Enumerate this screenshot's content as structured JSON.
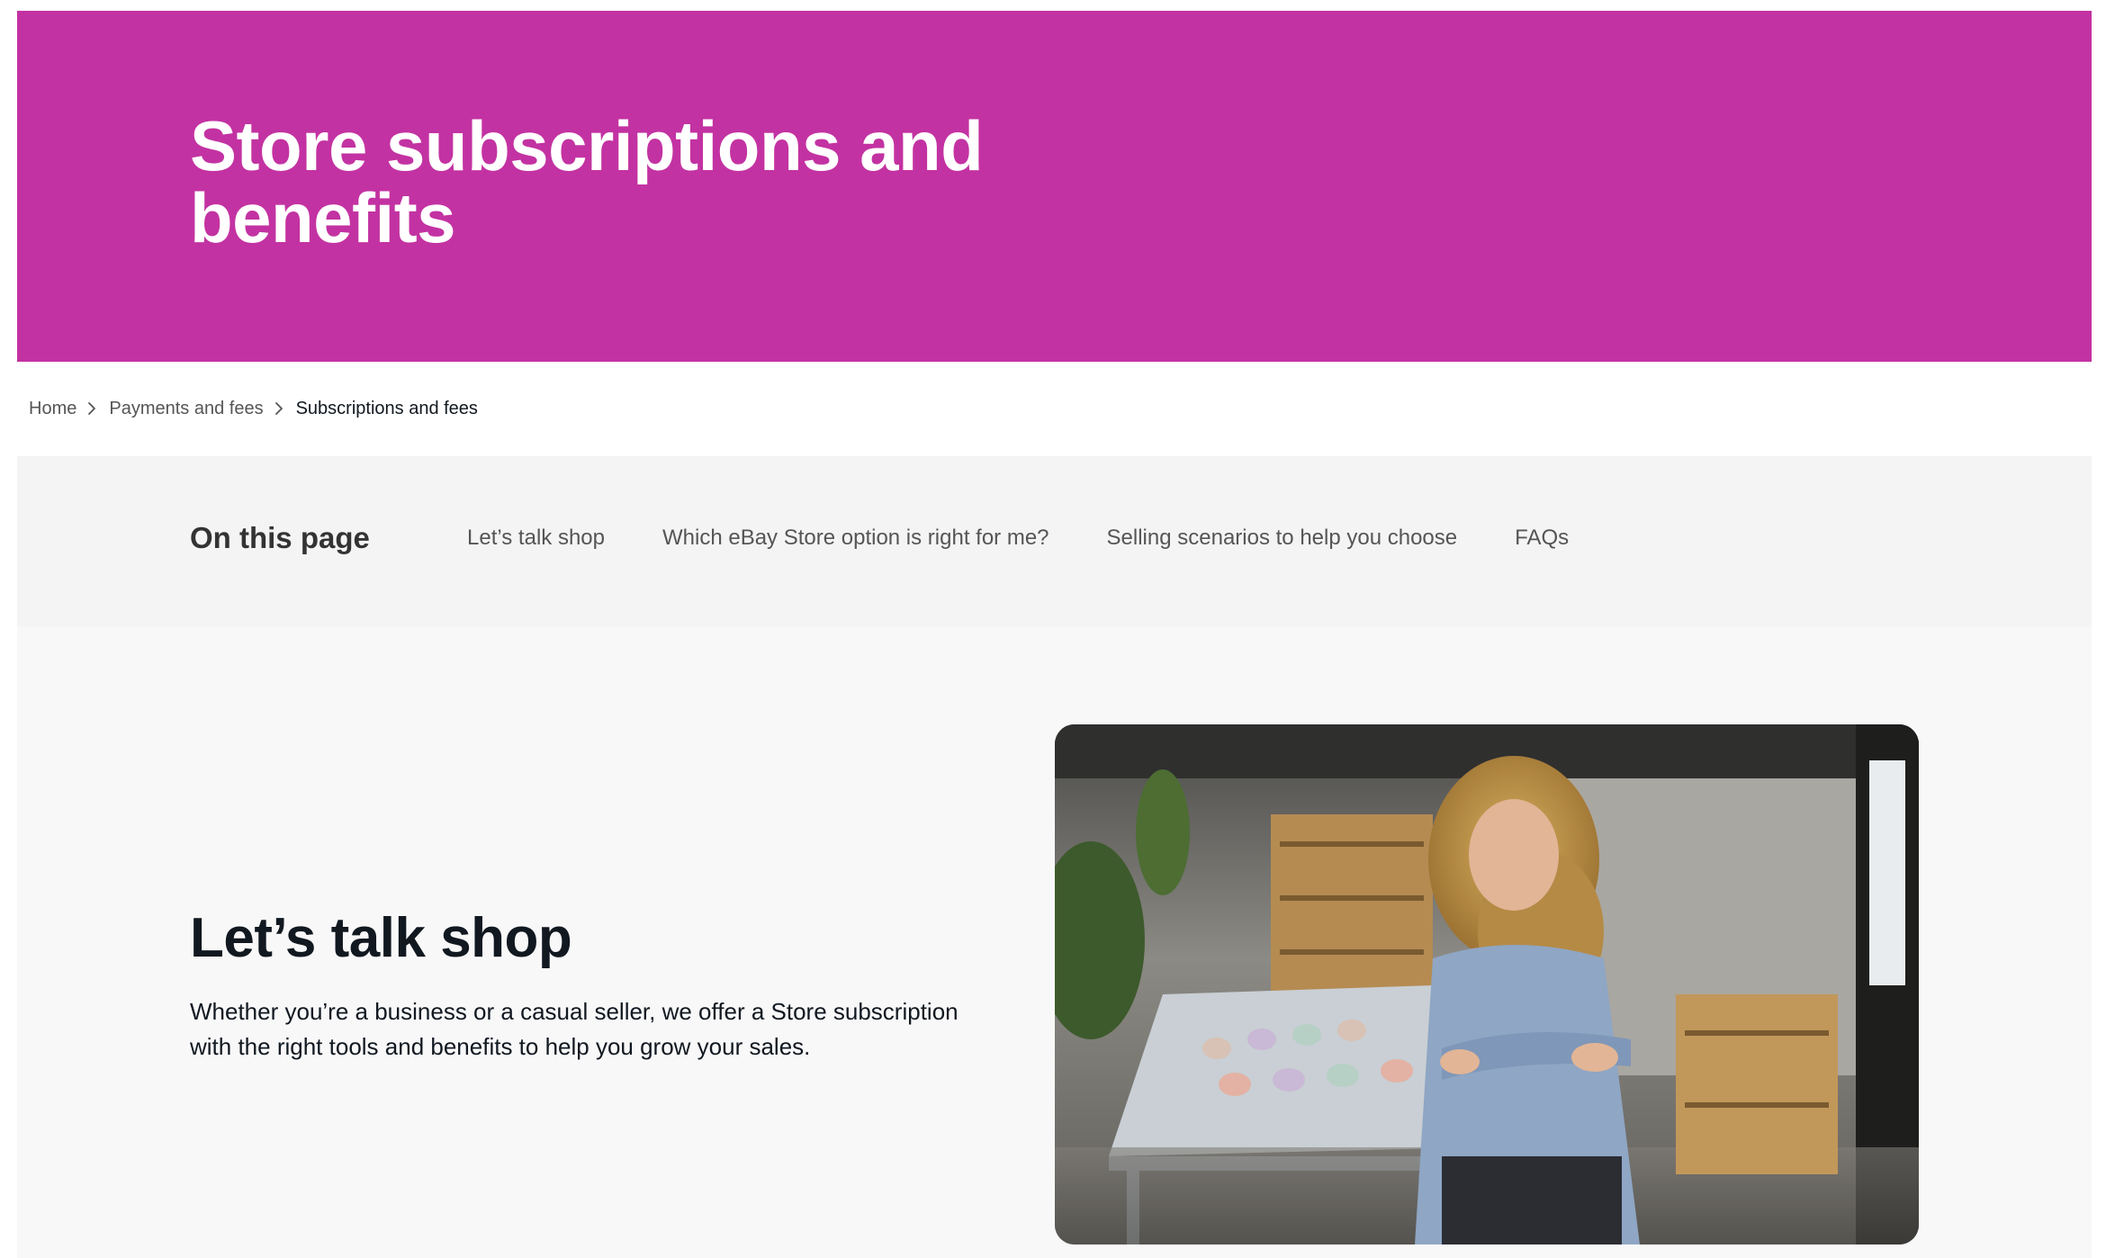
{
  "hero": {
    "title": "Store subscriptions and benefits",
    "background_color": "#c332a2"
  },
  "breadcrumb": {
    "items": [
      "Home",
      "Payments and fees",
      "Subscriptions and fees"
    ],
    "separator_icon": "chevron-right-icon"
  },
  "on_this_page": {
    "title": "On this page",
    "links": [
      "Let’s talk shop",
      "Which eBay Store option is right for me?",
      "Selling scenarios to help you choose",
      "FAQs"
    ]
  },
  "section": {
    "title": "Let’s talk shop",
    "body": "Whether you’re a business or a casual seller, we offer a Store subscription with the right tools and benefits to help you grow your sales.",
    "image_subject": "woman-in-pottery-shop-photo"
  }
}
